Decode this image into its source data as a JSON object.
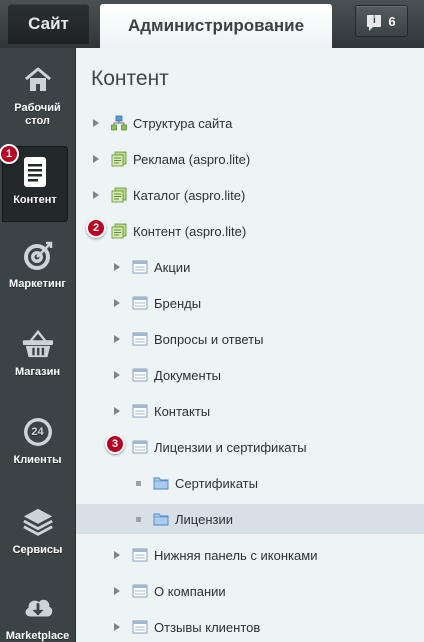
{
  "header": {
    "site_tab": "Сайт",
    "admin_tab": "Администрирование",
    "notifications_count": "6",
    "notifications_icon_glyph": "i"
  },
  "sidebar": {
    "items": [
      {
        "label": "Рабочий стол",
        "icon": "home-icon"
      },
      {
        "label": "Контент",
        "icon": "document-icon",
        "active": true
      },
      {
        "label": "Маркетинг",
        "icon": "target-icon"
      },
      {
        "label": "Магазин",
        "icon": "basket-icon"
      },
      {
        "label": "Клиенты",
        "icon": "clients-24-icon",
        "icon_text": "24"
      },
      {
        "label": "Сервисы",
        "icon": "layers-icon"
      },
      {
        "label": "Marketplace",
        "icon": "cloud-download-icon"
      }
    ]
  },
  "main": {
    "title": "Контент",
    "tree": [
      {
        "label": "Структура сайта",
        "icon": "sitemap-icon",
        "level": 0
      },
      {
        "label": "Реклама (aspro.lite)",
        "icon": "iblock-type-icon",
        "level": 0
      },
      {
        "label": "Каталог (aspro.lite)",
        "icon": "iblock-type-icon",
        "level": 0
      },
      {
        "label": "Контент (aspro.lite)",
        "icon": "iblock-type-icon",
        "level": 0,
        "expanded": true
      },
      {
        "label": "Акции",
        "icon": "iblock-icon",
        "level": 1
      },
      {
        "label": "Бренды",
        "icon": "iblock-icon",
        "level": 1
      },
      {
        "label": "Вопросы и ответы",
        "icon": "iblock-icon",
        "level": 1
      },
      {
        "label": "Документы",
        "icon": "iblock-icon",
        "level": 1
      },
      {
        "label": "Контакты",
        "icon": "iblock-icon",
        "level": 1
      },
      {
        "label": "Лицензии и сертификаты",
        "icon": "iblock-icon",
        "level": 1,
        "expanded": true
      },
      {
        "label": "Сертификаты",
        "icon": "folder-icon",
        "level": 2
      },
      {
        "label": "Лицензии",
        "icon": "folder-icon",
        "level": 2,
        "selected": true
      },
      {
        "label": "Нижняя панель с иконками",
        "icon": "iblock-icon",
        "level": 1
      },
      {
        "label": "О компании",
        "icon": "iblock-icon",
        "level": 1
      },
      {
        "label": "Отзывы клиентов",
        "icon": "iblock-icon",
        "level": 1
      }
    ]
  },
  "callouts": [
    "1",
    "2",
    "3"
  ],
  "colors": {
    "callout": "#b8001f",
    "sidebar_bg": "#3c4346",
    "content_bg": "#eef3f5",
    "selected_row": "#d6e0e5"
  }
}
